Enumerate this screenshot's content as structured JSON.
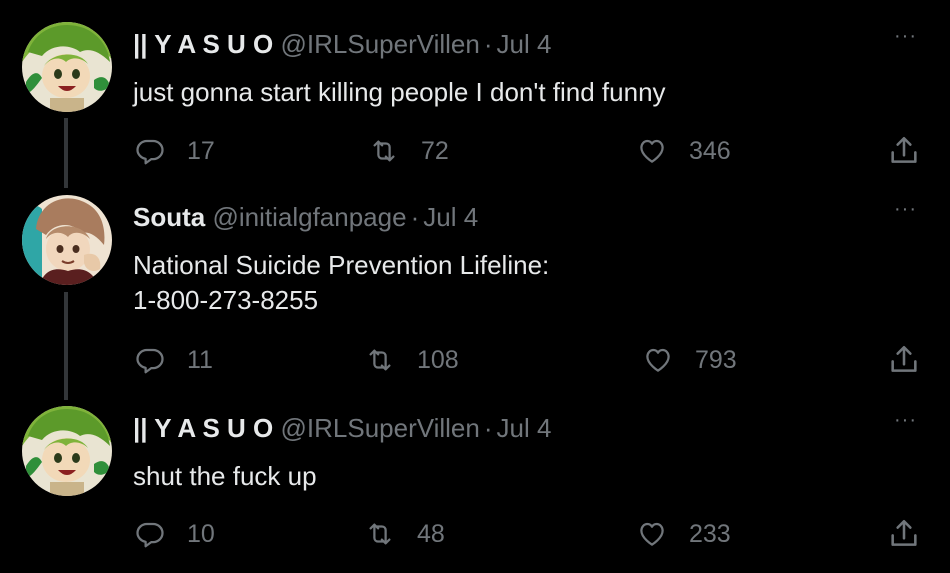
{
  "tweets": [
    {
      "name": "|| Y A S U O",
      "handle": "@IRLSuperVillen",
      "date": "Jul 4",
      "text_lines": [
        "just gonna start killing people I don't find funny"
      ],
      "replies": "17",
      "retweets": "72",
      "likes": "346",
      "avatar": "green-haired-character-avatar"
    },
    {
      "name": "Souta",
      "handle": "@initialgfanpage",
      "date": "Jul 4",
      "text_lines": [
        "National Suicide Prevention Lifeline:",
        "1-800-273-8255"
      ],
      "replies": "11",
      "retweets": "108",
      "likes": "793",
      "avatar": "brown-haired-character-avatar"
    },
    {
      "name": "|| Y A S U O",
      "handle": "@IRLSuperVillen",
      "date": "Jul 4",
      "text_lines": [
        "shut the fuck up"
      ],
      "replies": "10",
      "retweets": "48",
      "likes": "233",
      "avatar": "green-haired-character-avatar"
    }
  ],
  "separator": "·",
  "more_glyph": "···",
  "colors": {
    "background": "#000000",
    "text": "#e7e9ea",
    "muted": "#71767b",
    "thread_line": "#333639"
  },
  "icons": [
    "reply-icon",
    "retweet-icon",
    "like-icon",
    "share-icon",
    "more-icon"
  ]
}
